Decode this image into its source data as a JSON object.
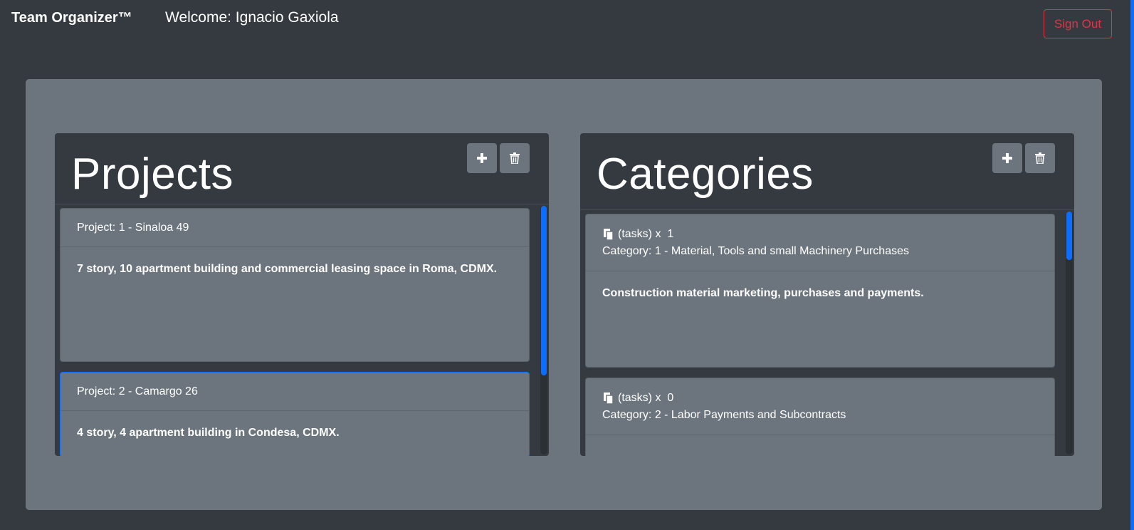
{
  "navbar": {
    "brand": "Team Organizer™",
    "welcome": "Welcome: Ignacio Gaxiola",
    "sign_out": "Sign Out"
  },
  "projects": {
    "title": "Projects",
    "add_icon": "plus-icon",
    "delete_icon": "trash-icon",
    "items": [
      {
        "header": "Project: 1 - Sinaloa 49",
        "description": "7 story, 10 apartment building and commercial leasing space in Roma, CDMX."
      },
      {
        "header": "Project: 2 - Camargo 26",
        "description": "4 story, 4 apartment building in Condesa, CDMX."
      }
    ]
  },
  "categories": {
    "title": "Categories",
    "add_icon": "plus-icon",
    "delete_icon": "trash-icon",
    "items": [
      {
        "tasks_label": "(tasks) x  1",
        "header": "Category: 1 - Material, Tools and small Machinery Purchases",
        "description": "Construction material marketing, purchases and payments."
      },
      {
        "tasks_label": "(tasks) x  0",
        "header": "Category: 2 - Labor Payments and Subcontracts",
        "description": ""
      }
    ]
  },
  "colors": {
    "background": "#343a40",
    "jumbotron": "#6c757d",
    "sign_out": "#dc3545",
    "accent": "#0d6efd"
  }
}
